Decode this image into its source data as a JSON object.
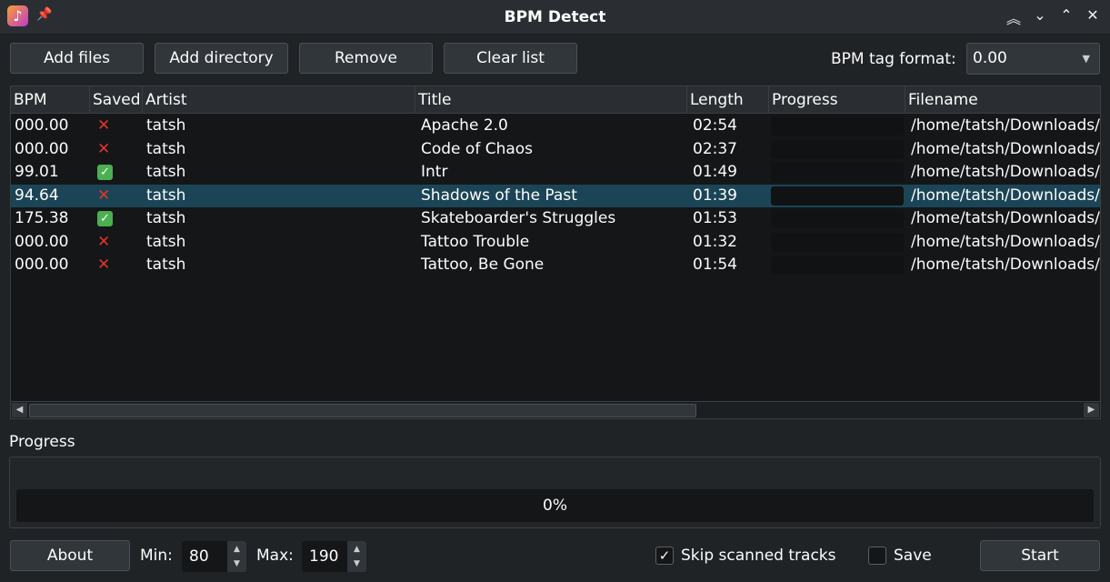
{
  "window": {
    "title": "BPM Detect",
    "app_icon": "music-note-icon"
  },
  "toolbar": {
    "add_files": "Add files",
    "add_directory": "Add directory",
    "remove": "Remove",
    "clear_list": "Clear list",
    "tag_format_label": "BPM tag format:",
    "tag_format_value": "0.00"
  },
  "table": {
    "columns": [
      "BPM",
      "Saved",
      "Artist",
      "Title",
      "Length",
      "Progress",
      "Filename"
    ],
    "rows": [
      {
        "bpm": "000.00",
        "saved": false,
        "artist": "tatsh",
        "title": "Apache 2.0",
        "length": "02:54",
        "filename": "/home/tatsh/Downloads/"
      },
      {
        "bpm": "000.00",
        "saved": false,
        "artist": "tatsh",
        "title": "Code of Chaos",
        "length": "02:37",
        "filename": "/home/tatsh/Downloads/"
      },
      {
        "bpm": "99.01",
        "saved": true,
        "artist": "tatsh",
        "title": "Intr",
        "length": "01:49",
        "filename": "/home/tatsh/Downloads/"
      },
      {
        "bpm": "94.64",
        "saved": false,
        "artist": "tatsh",
        "title": "Shadows of the Past",
        "length": "01:39",
        "filename": "/home/tatsh/Downloads/",
        "selected": true
      },
      {
        "bpm": "175.38",
        "saved": true,
        "artist": "tatsh",
        "title": "Skateboarder's Struggles",
        "length": "01:53",
        "filename": "/home/tatsh/Downloads/"
      },
      {
        "bpm": "000.00",
        "saved": false,
        "artist": "tatsh",
        "title": "Tattoo Trouble",
        "length": "01:32",
        "filename": "/home/tatsh/Downloads/"
      },
      {
        "bpm": "000.00",
        "saved": false,
        "artist": "tatsh",
        "title": "Tattoo, Be Gone",
        "length": "01:54",
        "filename": "/home/tatsh/Downloads/"
      }
    ]
  },
  "progress": {
    "label": "Progress",
    "text": "0%",
    "value": 0
  },
  "bottom": {
    "about": "About",
    "min_label": "Min:",
    "min_value": "80",
    "max_label": "Max:",
    "max_value": "190",
    "skip_label": "Skip scanned tracks",
    "skip_checked": true,
    "save_label": "Save",
    "save_checked": false,
    "start": "Start"
  }
}
